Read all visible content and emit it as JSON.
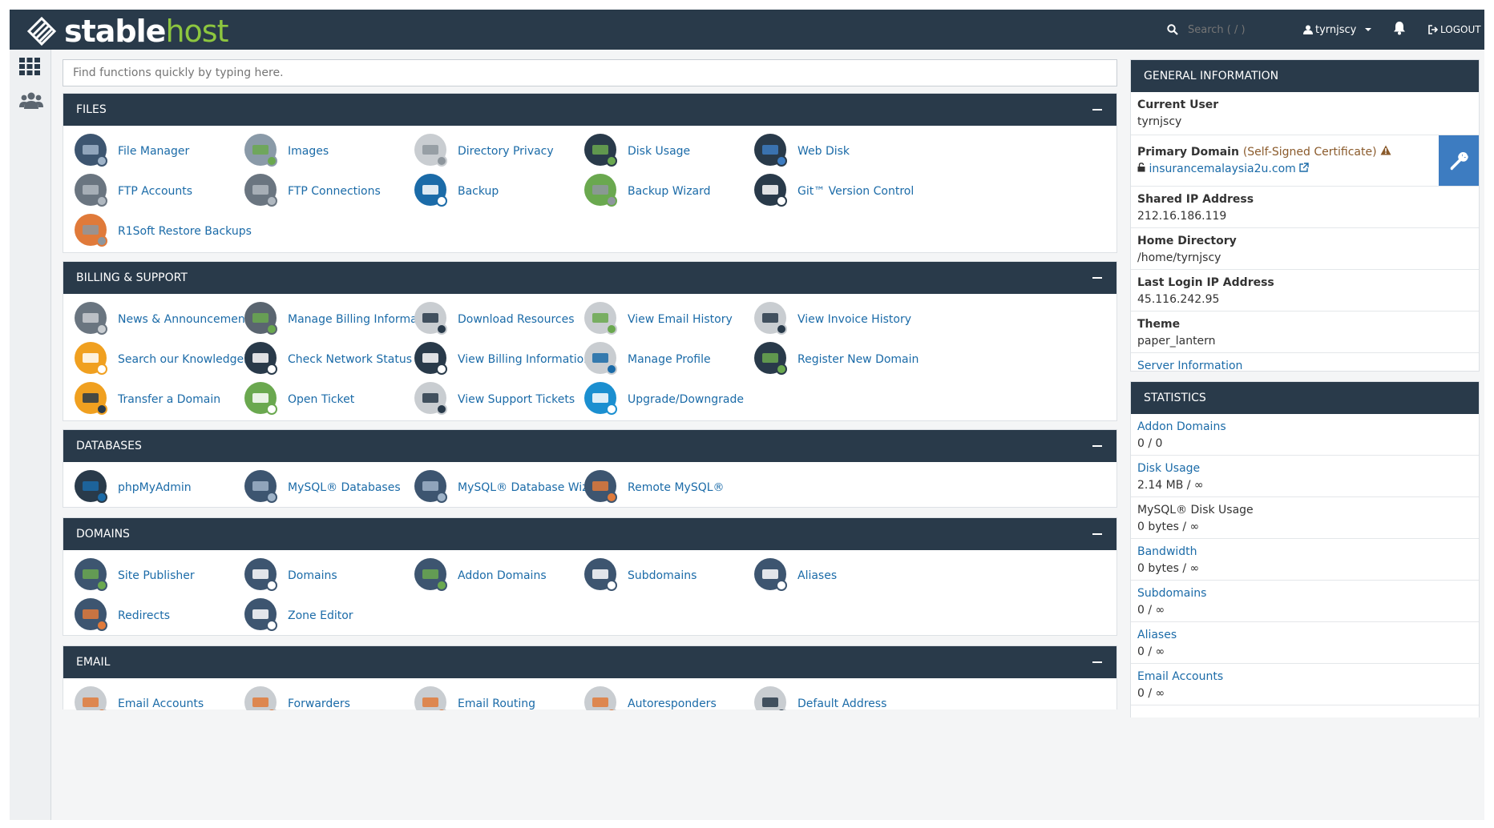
{
  "header": {
    "logo_part1": "stable",
    "logo_part2": "host",
    "search_placeholder": "Search ( / )",
    "username": "tyrnjscy",
    "logout_label": "LOGOUT"
  },
  "colors": {
    "header_bg": "#293a4a",
    "link": "#1b6ba8",
    "brand_green": "#8dc63f",
    "accent_blue": "#3d7cc1"
  },
  "quickfind": {
    "placeholder": "Find functions quickly by typing here."
  },
  "sections": {
    "files": {
      "title": "FILES",
      "items": [
        {
          "label": "File Manager",
          "icon": "file-manager-icon"
        },
        {
          "label": "Images",
          "icon": "images-icon"
        },
        {
          "label": "Directory Privacy",
          "icon": "directory-privacy-icon"
        },
        {
          "label": "Disk Usage",
          "icon": "disk-usage-icon"
        },
        {
          "label": "Web Disk",
          "icon": "web-disk-icon"
        },
        {
          "label": "FTP Accounts",
          "icon": "ftp-accounts-icon"
        },
        {
          "label": "FTP Connections",
          "icon": "ftp-connections-icon"
        },
        {
          "label": "Backup",
          "icon": "backup-icon"
        },
        {
          "label": "Backup Wizard",
          "icon": "backup-wizard-icon"
        },
        {
          "label": "Git™ Version Control",
          "icon": "git-icon"
        },
        {
          "label": "R1Soft Restore Backups",
          "icon": "r1soft-icon"
        }
      ]
    },
    "billing": {
      "title": "BILLING & SUPPORT",
      "items": [
        {
          "label": "News & Announcements",
          "icon": "megaphone-icon"
        },
        {
          "label": "Manage Billing Information",
          "icon": "credit-card-icon"
        },
        {
          "label": "Download Resources",
          "icon": "download-icon"
        },
        {
          "label": "View Email History",
          "icon": "email-history-icon"
        },
        {
          "label": "View Invoice History",
          "icon": "invoice-icon"
        },
        {
          "label": "Search our Knowledgebase",
          "icon": "knowledgebase-icon"
        },
        {
          "label": "Check Network Status",
          "icon": "network-status-icon"
        },
        {
          "label": "View Billing Information",
          "icon": "billing-info-icon"
        },
        {
          "label": "Manage Profile",
          "icon": "profile-icon"
        },
        {
          "label": "Register New Domain",
          "icon": "register-domain-icon"
        },
        {
          "label": "Transfer a Domain",
          "icon": "transfer-domain-icon"
        },
        {
          "label": "Open Ticket",
          "icon": "open-ticket-icon"
        },
        {
          "label": "View Support Tickets",
          "icon": "support-tickets-icon"
        },
        {
          "label": "Upgrade/Downgrade",
          "icon": "upgrade-icon"
        }
      ]
    },
    "databases": {
      "title": "DATABASES",
      "items": [
        {
          "label": "phpMyAdmin",
          "icon": "phpmyadmin-icon"
        },
        {
          "label": "MySQL® Databases",
          "icon": "mysql-databases-icon"
        },
        {
          "label": "MySQL® Database Wizard",
          "icon": "mysql-wizard-icon"
        },
        {
          "label": "Remote MySQL®",
          "icon": "remote-mysql-icon"
        }
      ]
    },
    "domains": {
      "title": "DOMAINS",
      "items": [
        {
          "label": "Site Publisher",
          "icon": "site-publisher-icon"
        },
        {
          "label": "Domains",
          "icon": "domains-icon"
        },
        {
          "label": "Addon Domains",
          "icon": "addon-domains-icon"
        },
        {
          "label": "Subdomains",
          "icon": "subdomains-icon"
        },
        {
          "label": "Aliases",
          "icon": "aliases-icon"
        },
        {
          "label": "Redirects",
          "icon": "redirects-icon"
        },
        {
          "label": "Zone Editor",
          "icon": "zone-editor-icon"
        }
      ]
    },
    "email": {
      "title": "EMAIL",
      "items": [
        {
          "label": "Email Accounts",
          "icon": "email-accounts-icon"
        },
        {
          "label": "Forwarders",
          "icon": "forwarders-icon"
        },
        {
          "label": "Email Routing",
          "icon": "email-routing-icon"
        },
        {
          "label": "Autoresponders",
          "icon": "autoresponders-icon"
        },
        {
          "label": "Default Address",
          "icon": "default-address-icon"
        }
      ]
    }
  },
  "general_info": {
    "title": "GENERAL INFORMATION",
    "current_user_label": "Current User",
    "current_user": "tyrnjscy",
    "primary_domain_label": "Primary Domain",
    "primary_domain_note": "(Self-Signed Certificate)",
    "primary_domain": "insurancemalaysia2u.com",
    "shared_ip_label": "Shared IP Address",
    "shared_ip": "212.16.186.119",
    "home_dir_label": "Home Directory",
    "home_dir": "/home/tyrnjscy",
    "last_login_label": "Last Login IP Address",
    "last_login": "45.116.242.95",
    "theme_label": "Theme",
    "theme": "paper_lantern",
    "server_info_link": "Server Information"
  },
  "statistics": {
    "title": "STATISTICS",
    "rows": [
      {
        "label": "Addon Domains",
        "value": "0 / 0"
      },
      {
        "label": "Disk Usage",
        "value": "2.14 MB / ∞"
      },
      {
        "label": "MySQL® Disk Usage",
        "value": "0 bytes / ∞"
      },
      {
        "label": "Bandwidth",
        "value": "0 bytes / ∞"
      },
      {
        "label": "Subdomains",
        "value": "0 / ∞"
      },
      {
        "label": "Aliases",
        "value": "0 / ∞"
      },
      {
        "label": "Email Accounts",
        "value": "0 / ∞"
      }
    ]
  }
}
